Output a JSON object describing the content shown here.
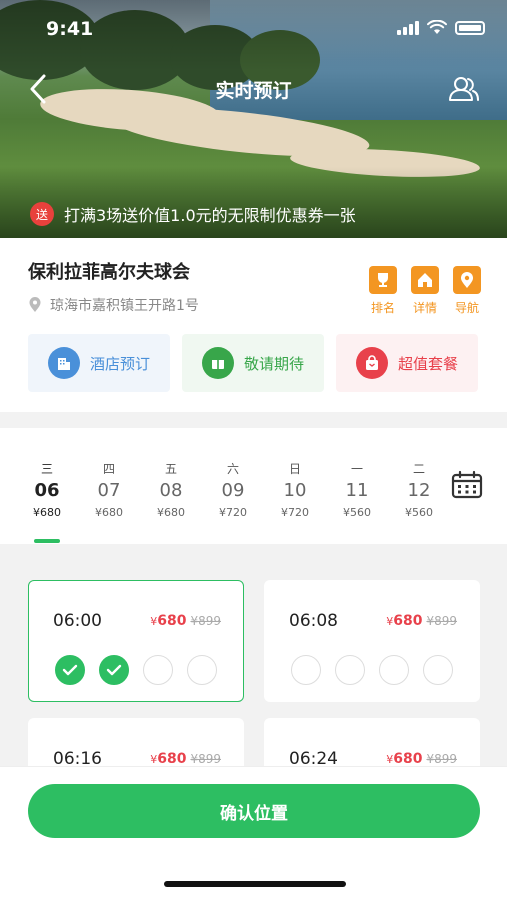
{
  "status_bar": {
    "time": "9:41"
  },
  "nav": {
    "title": "实时预订"
  },
  "promo": {
    "badge": "送",
    "text": "打满3场送价值1.0元的无限制优惠券一张"
  },
  "club": {
    "name": "保利拉菲高尔夫球会",
    "address": "琼海市嘉积镇王开路1号"
  },
  "quick_links": [
    {
      "label": "排名",
      "icon": "trophy-icon"
    },
    {
      "label": "详情",
      "icon": "home-icon"
    },
    {
      "label": "导航",
      "icon": "location-pin-icon"
    }
  ],
  "services": [
    {
      "label": "酒店预订",
      "icon": "hotel-icon",
      "color": "#4a90d9"
    },
    {
      "label": "敬请期待",
      "icon": "more-icon",
      "color": "#38a64a"
    },
    {
      "label": "超值套餐",
      "icon": "gift-bag-icon",
      "color": "#e8414b"
    }
  ],
  "dates": [
    {
      "dow": "三",
      "day": "06",
      "price": "¥680"
    },
    {
      "dow": "四",
      "day": "07",
      "price": "¥680"
    },
    {
      "dow": "五",
      "day": "08",
      "price": "¥680"
    },
    {
      "dow": "六",
      "day": "09",
      "price": "¥720"
    },
    {
      "dow": "日",
      "day": "10",
      "price": "¥720"
    },
    {
      "dow": "一",
      "day": "11",
      "price": "¥560"
    },
    {
      "dow": "二",
      "day": "12",
      "price": "¥560"
    }
  ],
  "selected_date": "06",
  "slots": [
    {
      "time": "06:00",
      "currency": "¥",
      "price": "680",
      "original": "¥899",
      "seats_booked": 2,
      "selected": true
    },
    {
      "time": "06:08",
      "currency": "¥",
      "price": "680",
      "original": "¥899",
      "seats_booked": 0,
      "selected": false
    },
    {
      "time": "06:16",
      "currency": "¥",
      "price": "680",
      "original": "¥899",
      "seats_booked": 0,
      "selected": false
    },
    {
      "time": "06:24",
      "currency": "¥",
      "price": "680",
      "original": "¥899",
      "seats_booked": 0,
      "selected": false
    }
  ],
  "confirm_label": "确认位置",
  "colors": {
    "accent": "#2dbe62",
    "price": "#e8414b",
    "quick_link": "#f39622"
  }
}
